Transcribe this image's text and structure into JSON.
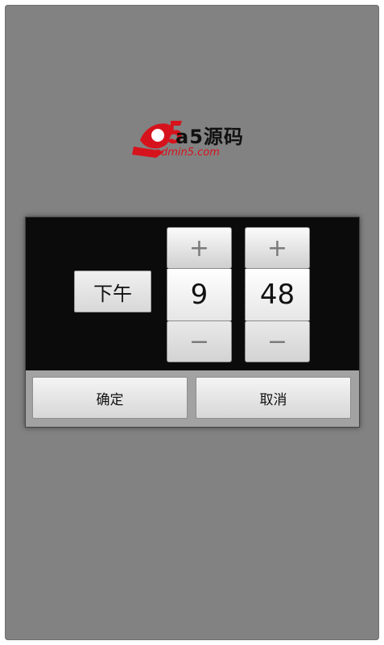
{
  "logo": {
    "name": "a5源码",
    "domain": "admin5.com",
    "brand_color": "#d6131c"
  },
  "time_picker": {
    "ampm_label": "下午",
    "hour": "9",
    "minute": "48",
    "increment_symbol": "+",
    "decrement_symbol": "−"
  },
  "buttons": {
    "confirm_label": "确定",
    "cancel_label": "取消"
  },
  "colors": {
    "screen_bg": "#828282",
    "dialog_bg": "#0b0b0b",
    "button_bar_bg": "#a2a2a2"
  }
}
